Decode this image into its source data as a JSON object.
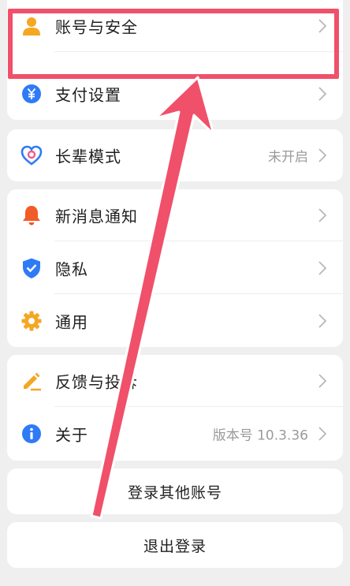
{
  "settings": {
    "items": [
      {
        "label": "账号与安全",
        "icon": "person-icon",
        "color": "#f5a623"
      },
      {
        "label": "支付设置",
        "icon": "yuan-coin-icon",
        "color": "#2f7bf6"
      },
      {
        "label": "长辈模式",
        "icon": "heart-shield-icon",
        "color": "#2f7bf6",
        "value": "未开启"
      },
      {
        "label": "新消息通知",
        "icon": "bell-icon",
        "color": "#f25a28"
      },
      {
        "label": "隐私",
        "icon": "shield-check-icon",
        "color": "#2f7bf6"
      },
      {
        "label": "通用",
        "icon": "gear-icon",
        "color": "#f5a623"
      },
      {
        "label": "反馈与投诉",
        "icon": "edit-pen-icon",
        "color": "#f5a623"
      },
      {
        "label": "关于",
        "icon": "info-icon",
        "color": "#2f7bf6",
        "value": "版本号 10.3.36"
      }
    ],
    "login_other": "登录其他账号",
    "logout": "退出登录"
  },
  "annotation": {
    "highlight_color": "#f0506a",
    "arrow_color": "#f0506a"
  }
}
